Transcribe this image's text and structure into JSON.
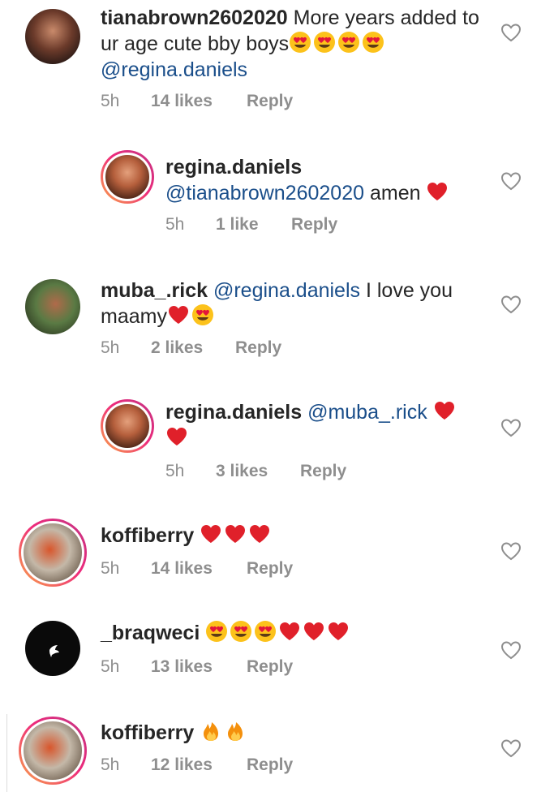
{
  "comments": [
    {
      "username": "tianabrown2602020",
      "text_before": "More years added to ur age cute bby boys",
      "emojis_after": [
        "heart-eyes",
        "heart-eyes",
        "heart-eyes",
        "heart-eyes"
      ],
      "mention": "@regina.daniels",
      "time": "5h",
      "likes": "14 likes",
      "reply": "Reply"
    },
    {
      "username": "regina.daniels",
      "mention": "@tianabrown2602020",
      "text": "amen",
      "emojis": [
        "red-heart"
      ],
      "time": "5h",
      "likes": "1 like",
      "reply": "Reply"
    },
    {
      "username": "muba_.rick",
      "mention": "@regina.daniels",
      "text": "I love you maamy",
      "emojis": [
        "red-heart",
        "heart-eyes"
      ],
      "time": "5h",
      "likes": "2 likes",
      "reply": "Reply"
    },
    {
      "username": "regina.daniels",
      "mention": "@muba_.rick",
      "emojis": [
        "red-heart",
        "red-heart"
      ],
      "time": "5h",
      "likes": "3 likes",
      "reply": "Reply"
    },
    {
      "username": "koffiberry",
      "emojis": [
        "red-heart",
        "red-heart",
        "red-heart"
      ],
      "time": "5h",
      "likes": "14 likes",
      "reply": "Reply"
    },
    {
      "username": "_braqweci",
      "emojis": [
        "heart-eyes",
        "heart-eyes",
        "heart-eyes",
        "red-heart",
        "red-heart",
        "red-heart"
      ],
      "time": "5h",
      "likes": "13 likes",
      "reply": "Reply"
    },
    {
      "username": "koffiberry",
      "emojis": [
        "fire",
        "fire"
      ],
      "time": "5h",
      "likes": "12 likes",
      "reply": "Reply"
    }
  ],
  "colors": {
    "mention": "#1a4e8a",
    "meta": "#8e8e8e",
    "heart_emoji": "#e0202a",
    "story_ring_start": "#f9a64a",
    "story_ring_end": "#c13584"
  },
  "icons": {
    "like": "heart-outline-icon"
  }
}
